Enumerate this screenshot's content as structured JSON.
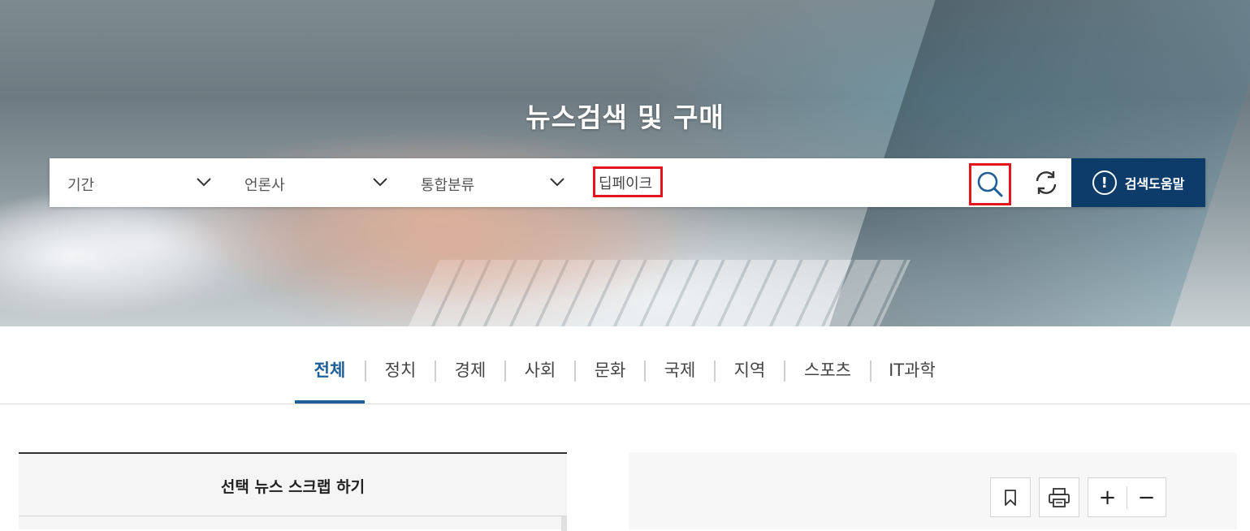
{
  "hero": {
    "title": "뉴스검색 및 구매"
  },
  "search": {
    "period_label": "기간",
    "press_label": "언론사",
    "category_label": "통합분류",
    "query_value": "딥페이크",
    "help_label": "검색도움말"
  },
  "icons": {
    "search": "search-icon",
    "reset": "refresh-icon",
    "help": "exclamation-circle-icon",
    "dropdown": "chevron-down-icon",
    "bookmark": "bookmark-icon",
    "print": "printer-icon"
  },
  "colors": {
    "accent": "#1e5f98",
    "help_button_bg": "#0d3c6b",
    "highlight": "#e3161f"
  },
  "tabs": [
    {
      "label": "전체",
      "active": true
    },
    {
      "label": "정치",
      "active": false
    },
    {
      "label": "경제",
      "active": false
    },
    {
      "label": "사회",
      "active": false
    },
    {
      "label": "문화",
      "active": false
    },
    {
      "label": "국제",
      "active": false
    },
    {
      "label": "지역",
      "active": false
    },
    {
      "label": "스포츠",
      "active": false
    },
    {
      "label": "IT과학",
      "active": false
    }
  ],
  "scrap": {
    "title": "선택 뉴스 스크랩 하기"
  },
  "tools": {
    "zoom_in": "+",
    "zoom_out": "−"
  }
}
